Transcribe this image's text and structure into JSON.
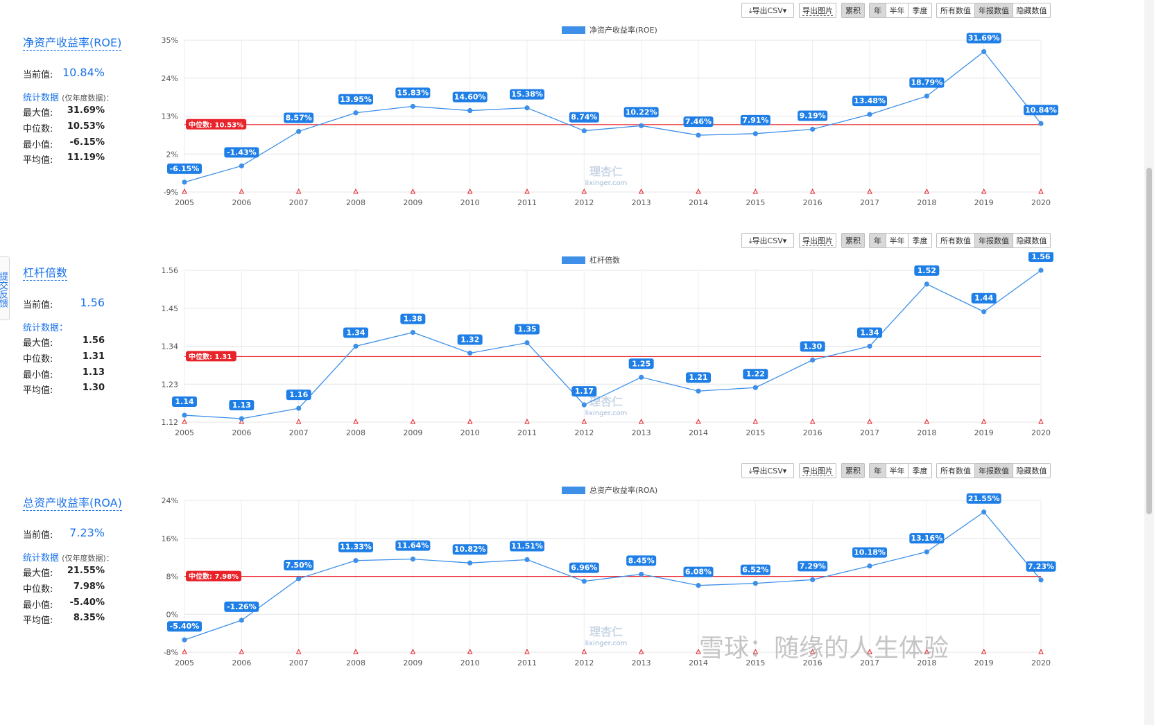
{
  "feedback_label": "提交反馈",
  "toolbar": {
    "export_csv": "导出CSV",
    "export_image": "导出图片",
    "cumulative": "累积",
    "year": "年",
    "half_year": "半年",
    "quarter": "季度",
    "all_values": "所有数值",
    "annual_values": "年报数值",
    "hide_values": "隐藏数值"
  },
  "watermark": {
    "logo": "理杏仁",
    "site": "lixinger.com"
  },
  "bottom_watermark": "雪球：随缘的人生体验",
  "sections": [
    {
      "title": "净资产收益率(ROE)",
      "current_label": "当前值:",
      "current_value": "10.84%",
      "stats_label": "统计数据",
      "stats_note": "(仅年度数据)：",
      "stats": [
        {
          "label": "最大值:",
          "value": "31.69%"
        },
        {
          "label": "中位数:",
          "value": "10.53%"
        },
        {
          "label": "最小值:",
          "value": "-6.15%"
        },
        {
          "label": "平均值:",
          "value": "11.19%"
        }
      ]
    },
    {
      "title": "杠杆倍数",
      "current_label": "当前值:",
      "current_value": "1.56",
      "stats_label": "统计数据：",
      "stats_note": "",
      "stats": [
        {
          "label": "最大值:",
          "value": "1.56"
        },
        {
          "label": "中位数:",
          "value": "1.31"
        },
        {
          "label": "最小值:",
          "value": "1.13"
        },
        {
          "label": "平均值:",
          "value": "1.30"
        }
      ]
    },
    {
      "title": "总资产收益率(ROA)",
      "current_label": "当前值:",
      "current_value": "7.23%",
      "stats_label": "统计数据",
      "stats_note": "(仅年度数据)：",
      "stats": [
        {
          "label": "最大值:",
          "value": "21.55%"
        },
        {
          "label": "中位数:",
          "value": "7.98%"
        },
        {
          "label": "最小值:",
          "value": "-5.40%"
        },
        {
          "label": "平均值:",
          "value": "8.35%"
        }
      ]
    }
  ],
  "chart_data": [
    {
      "type": "line",
      "legend": "净资产收益率(ROE)",
      "x": [
        "2005",
        "2006",
        "2007",
        "2008",
        "2009",
        "2010",
        "2011",
        "2012",
        "2013",
        "2014",
        "2015",
        "2016",
        "2017",
        "2018",
        "2019",
        "2020"
      ],
      "values": [
        -6.15,
        -1.43,
        8.57,
        13.95,
        15.83,
        14.6,
        15.38,
        8.74,
        10.22,
        7.46,
        7.91,
        9.19,
        13.48,
        18.79,
        31.69,
        10.84
      ],
      "point_labels": [
        "-6.15%",
        "-1.43%",
        "8.57%",
        "13.95%",
        "15.83%",
        "14.60%",
        "15.38%",
        "8.74%",
        "10.22%",
        "7.46%",
        "7.91%",
        "9.19%",
        "13.48%",
        "18.79%",
        "31.69%",
        "10.84%"
      ],
      "yticks": [
        -9,
        2,
        13,
        24,
        35
      ],
      "ytick_labels": [
        "-9%",
        "2%",
        "13%",
        "24%",
        "35%"
      ],
      "ylim": [
        -9,
        35
      ],
      "median": 10.53,
      "median_label": "中位数: 10.53%",
      "color": "#3d8fe8",
      "median_color": "#e8232a",
      "grid": true,
      "legend_position": "top-center"
    },
    {
      "type": "line",
      "legend": "杠杆倍数",
      "x": [
        "2005",
        "2006",
        "2007",
        "2008",
        "2009",
        "2010",
        "2011",
        "2012",
        "2013",
        "2014",
        "2015",
        "2016",
        "2017",
        "2018",
        "2019",
        "2020"
      ],
      "values": [
        1.14,
        1.13,
        1.16,
        1.34,
        1.38,
        1.32,
        1.35,
        1.17,
        1.25,
        1.21,
        1.22,
        1.3,
        1.34,
        1.52,
        1.44,
        1.56
      ],
      "point_labels": [
        "1.14",
        "1.13",
        "1.16",
        "1.34",
        "1.38",
        "1.32",
        "1.35",
        "1.17",
        "1.25",
        "1.21",
        "1.22",
        "1.30",
        "1.34",
        "1.52",
        "1.44",
        "1.56"
      ],
      "yticks": [
        1.12,
        1.23,
        1.34,
        1.45,
        1.56
      ],
      "ytick_labels": [
        "1.12",
        "1.23",
        "1.34",
        "1.45",
        "1.56"
      ],
      "ylim": [
        1.12,
        1.56
      ],
      "median": 1.31,
      "median_label": "中位数: 1.31",
      "color": "#3d8fe8",
      "median_color": "#e8232a",
      "grid": true,
      "legend_position": "top-center"
    },
    {
      "type": "line",
      "legend": "总资产收益率(ROA)",
      "x": [
        "2005",
        "2006",
        "2007",
        "2008",
        "2009",
        "2010",
        "2011",
        "2012",
        "2013",
        "2014",
        "2015",
        "2016",
        "2017",
        "2018",
        "2019",
        "2020"
      ],
      "values": [
        -5.4,
        -1.26,
        7.5,
        11.33,
        11.64,
        10.82,
        11.51,
        6.96,
        8.45,
        6.08,
        6.52,
        7.29,
        10.18,
        13.16,
        21.55,
        7.23
      ],
      "point_labels": [
        "-5.40%",
        "-1.26%",
        "7.50%",
        "11.33%",
        "11.64%",
        "10.82%",
        "11.51%",
        "6.96%",
        "8.45%",
        "6.08%",
        "6.52%",
        "7.29%",
        "10.18%",
        "13.16%",
        "21.55%",
        "7.23%"
      ],
      "yticks": [
        -8,
        0,
        8,
        16,
        24
      ],
      "ytick_labels": [
        "-8%",
        "0%",
        "8%",
        "16%",
        "24%"
      ],
      "ylim": [
        -8,
        24
      ],
      "median": 7.98,
      "median_label": "中位数: 7.98%",
      "color": "#3d8fe8",
      "median_color": "#e8232a",
      "grid": true,
      "legend_position": "top-center"
    }
  ]
}
